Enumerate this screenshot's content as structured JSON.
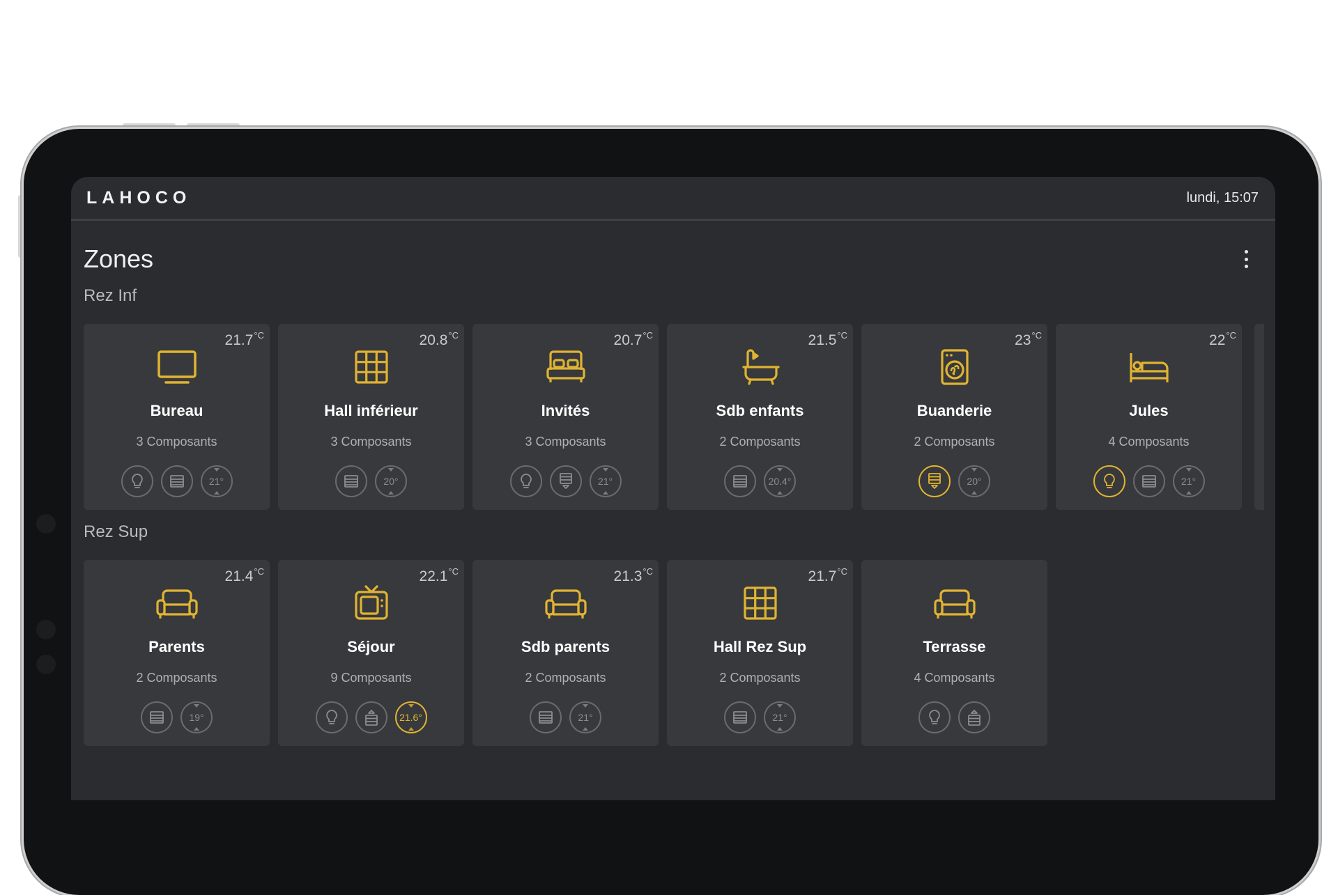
{
  "brand": "LAHOCO",
  "datetime": "lundi, 15:07",
  "page_title": "Zones",
  "accent_color": "#e0b432",
  "sections": [
    {
      "title": "Rez Inf",
      "zones": [
        {
          "name": "Bureau",
          "temp": "21.7",
          "unit": "°C",
          "icon": "monitor-icon",
          "components": "3 Composants",
          "chips": [
            {
              "type": "light",
              "active": false
            },
            {
              "type": "shutter",
              "active": false
            },
            {
              "type": "thermostat",
              "value": "21°",
              "active": false
            }
          ]
        },
        {
          "name": "Hall inférieur",
          "temp": "20.8",
          "unit": "°C",
          "icon": "grid-icon",
          "components": "3 Composants",
          "chips": [
            {
              "type": "shutter",
              "active": false
            },
            {
              "type": "thermostat",
              "value": "20°",
              "active": false
            }
          ]
        },
        {
          "name": "Invités",
          "temp": "20.7",
          "unit": "°C",
          "icon": "bed-icon",
          "components": "3 Composants",
          "chips": [
            {
              "type": "light",
              "active": false
            },
            {
              "type": "shutter-down",
              "active": false
            },
            {
              "type": "thermostat",
              "value": "21°",
              "active": false
            }
          ]
        },
        {
          "name": "Sdb enfants",
          "temp": "21.5",
          "unit": "°C",
          "icon": "bathtub-icon",
          "components": "2 Composants",
          "chips": [
            {
              "type": "shutter",
              "active": false
            },
            {
              "type": "thermostat",
              "value": "20.4°",
              "active": false
            }
          ]
        },
        {
          "name": "Buanderie",
          "temp": "23",
          "unit": "°C",
          "icon": "washing-machine-icon",
          "components": "2 Composants",
          "chips": [
            {
              "type": "shutter-down",
              "active": true
            },
            {
              "type": "thermostat",
              "value": "20°",
              "active": false
            }
          ]
        },
        {
          "name": "Jules",
          "temp": "22",
          "unit": "°C",
          "icon": "single-bed-icon",
          "components": "4 Composants",
          "chips": [
            {
              "type": "light",
              "active": true
            },
            {
              "type": "shutter",
              "active": false
            },
            {
              "type": "thermostat",
              "value": "21°",
              "active": false
            }
          ]
        }
      ]
    },
    {
      "title": "Rez Sup",
      "zones": [
        {
          "name": "Parents",
          "temp": "21.4",
          "unit": "°C",
          "icon": "sofa-icon",
          "components": "2 Composants",
          "chips": [
            {
              "type": "shutter",
              "active": false
            },
            {
              "type": "thermostat",
              "value": "19°",
              "active": false
            }
          ]
        },
        {
          "name": "Séjour",
          "temp": "22.1",
          "unit": "°C",
          "icon": "tv-icon",
          "components": "9 Composants",
          "chips": [
            {
              "type": "light",
              "active": false
            },
            {
              "type": "shutter-up",
              "active": false
            },
            {
              "type": "thermostat",
              "value": "21.6°",
              "active": true
            }
          ]
        },
        {
          "name": "Sdb parents",
          "temp": "21.3",
          "unit": "°C",
          "icon": "sofa-icon",
          "components": "2 Composants",
          "chips": [
            {
              "type": "shutter",
              "active": false
            },
            {
              "type": "thermostat",
              "value": "21°",
              "active": false
            }
          ]
        },
        {
          "name": "Hall Rez Sup",
          "temp": "21.7",
          "unit": "°C",
          "icon": "grid-icon",
          "components": "2 Composants",
          "chips": [
            {
              "type": "shutter",
              "active": false
            },
            {
              "type": "thermostat",
              "value": "21°",
              "active": false
            }
          ]
        },
        {
          "name": "Terrasse",
          "temp": "",
          "unit": "",
          "icon": "sofa-icon",
          "components": "4 Composants",
          "chips": [
            {
              "type": "light",
              "active": false
            },
            {
              "type": "shutter-up",
              "active": false
            }
          ]
        }
      ]
    }
  ]
}
